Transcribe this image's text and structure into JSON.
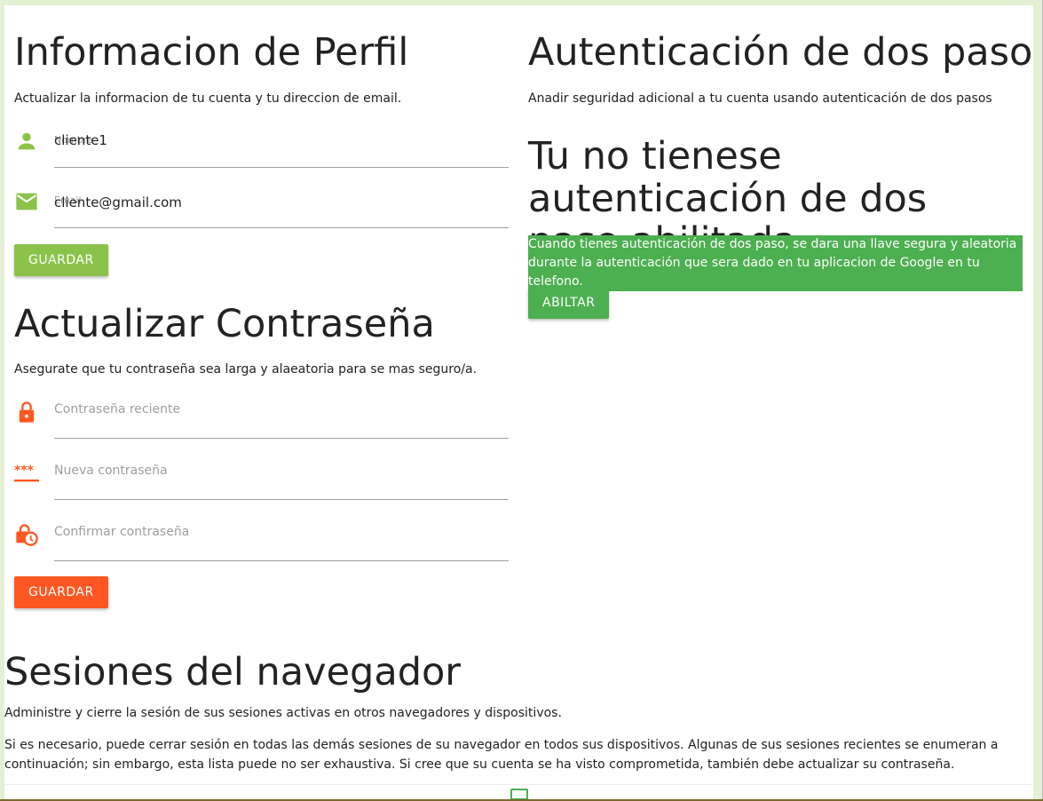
{
  "profile": {
    "title": "Informacion de Perfil",
    "description": "Actualizar la informacion de tu cuenta y tu direccion de email.",
    "name_label": "Nombre",
    "name_value": "cliente1",
    "email_label": "Email",
    "email_value": "cliente@gmail.com",
    "save_label": "GUARDAR"
  },
  "password": {
    "title": "Actualizar Contraseña",
    "description": "Asegurate que tu contraseña sea larga y alaeatoria para se mas seguro/a.",
    "current_placeholder": "Contraseña reciente",
    "new_placeholder": "Nueva contraseña",
    "confirm_placeholder": "Confirmar contraseña",
    "save_label": "GUARDAR"
  },
  "two_factor": {
    "title": "Autenticación de dos pasos",
    "description": "Anadir seguridad adicional a tu cuenta usando autenticación de dos pasos",
    "status_title": "Tu no tienese autenticación de dos paso abilitada.",
    "info": "Cuando tienes autenticación de dos paso, se dara una llave segura y aleatoria durante la autenticación que sera dado en tu aplicacion de Google en tu telefono.",
    "enable_label": "ABILTAR"
  },
  "sessions": {
    "title": "Sesiones del navegador",
    "description": "Administre y cierre la sesión de sus sesiones activas en otros navegadores y dispositivos.",
    "explanation": "Si es necesario, puede cerrar sesión en todas las demás sesiones de su navegador en todos sus dispositivos. Algunas de sus sesiones recientes se enumeran a continuación; sin embargo, esta lista puede no ser exhaustiva. Si cree que su cuenta se ha visto comprometida, también debe actualizar su contraseña."
  },
  "colors": {
    "profile_accent": "#8bc34a",
    "password_accent": "#ff5722",
    "two_factor_accent": "#4caf50"
  },
  "icons": {
    "name": "person-icon",
    "email": "envelope-icon",
    "current_password": "lock-icon",
    "new_password": "password-dots-icon",
    "confirm_password": "lock-clock-icon",
    "session_device": "monitor-icon"
  }
}
